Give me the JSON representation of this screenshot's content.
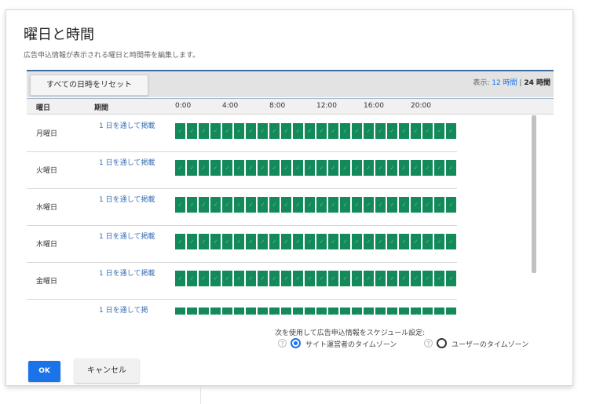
{
  "dialog": {
    "title": "曜日と時間",
    "subtitle": "広告申込情報が表示される曜日と時間帯を編集します。"
  },
  "toolbar": {
    "reset_label": "すべての日時をリセット",
    "display_prefix": "表示: ",
    "display_12": "12 時間",
    "display_sep": " | ",
    "display_24": "24 時間",
    "active_display": "24 時間"
  },
  "table": {
    "columns": {
      "day": "曜日",
      "period": "期間"
    },
    "time_labels": [
      "0:00",
      "4:00",
      "8:00",
      "12:00",
      "16:00",
      "20:00"
    ],
    "cell_mark": "✓",
    "cell_color": "#148a5a",
    "rows": [
      {
        "day": "月曜日",
        "period": "1 日を通して掲載",
        "selected_hours": 24
      },
      {
        "day": "火曜日",
        "period": "1 日を通して掲載",
        "selected_hours": 24
      },
      {
        "day": "水曜日",
        "period": "1 日を通して掲載",
        "selected_hours": 24
      },
      {
        "day": "木曜日",
        "period": "1 日を通して掲載",
        "selected_hours": 24
      },
      {
        "day": "金曜日",
        "period": "1 日を通して掲載",
        "selected_hours": 24
      },
      {
        "day": "",
        "period": "1 日を通して掲",
        "selected_hours": 24
      }
    ]
  },
  "timezone": {
    "label": "次を使用して広告申込情報をスケジュール設定:",
    "options": [
      {
        "label": "サイト運営者のタイムゾーン",
        "checked": true,
        "help_icon": "help-circle-icon"
      },
      {
        "label": "ユーザーのタイムゾーン",
        "checked": false,
        "help_icon": "help-circle-icon"
      }
    ]
  },
  "buttons": {
    "ok": "OK",
    "cancel": "キャンセル"
  },
  "colors": {
    "accent": "#1a73e8",
    "header_rule": "#3f6da1",
    "cell_green": "#148a5a"
  }
}
